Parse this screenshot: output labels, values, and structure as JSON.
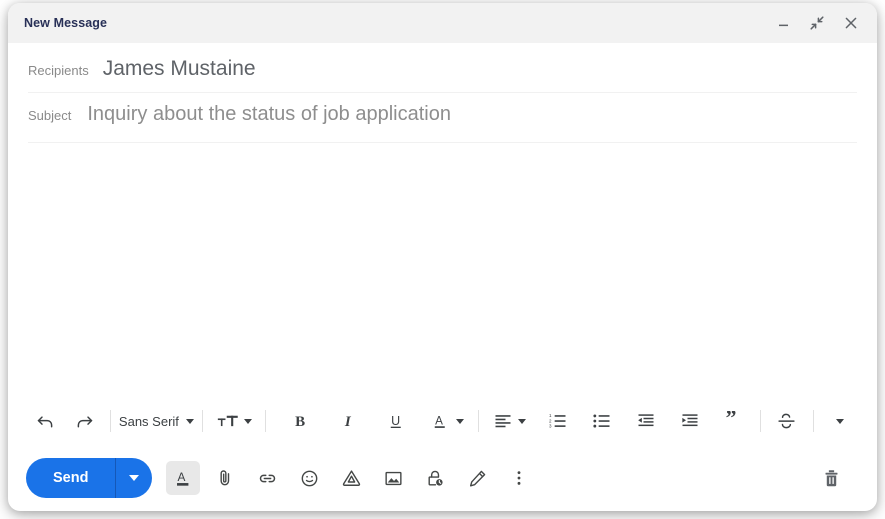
{
  "window": {
    "title": "New Message",
    "controls": [
      {
        "name": "minimize",
        "label": "Minimize"
      },
      {
        "name": "exit-full-screen",
        "label": "Exit full screen"
      },
      {
        "name": "close",
        "label": "Close"
      }
    ],
    "accent_blue": "#1a73e8",
    "header_bg": "#f2f2f2",
    "title_color": "#283057"
  },
  "fields": {
    "recipients_label": "Recipients",
    "recipients_value": "James Mustaine",
    "subject_label": "Subject",
    "subject_value": "Inquiry about the status of job application"
  },
  "body": {
    "text": ""
  },
  "format_toolbar": {
    "undo": "Undo",
    "redo": "Redo",
    "font_name": "Sans Serif",
    "text_size": "Size",
    "bold": "Bold",
    "italic": "Italic",
    "underline": "Underline",
    "text_color": "Text color",
    "align": "Align",
    "numbered_list": "Numbered list",
    "bulleted_list": "Bulleted list",
    "indent_less": "Indent less",
    "indent_more": "Indent more",
    "quote": "Quote",
    "strikethrough": "Strikethrough",
    "more_formatting": "More formatting options"
  },
  "action_bar": {
    "send_label": "Send",
    "send_options": "More send options",
    "formatting_options": "Formatting options",
    "attach_file": "Attach files",
    "insert_link": "Insert link",
    "insert_emoji": "Insert emoji",
    "insert_drive": "Insert files using Drive",
    "insert_photo": "Insert photo",
    "confidential_mode": "Toggle confidential mode",
    "insert_signature": "Insert signature",
    "more_options": "More options",
    "discard": "Discard draft"
  }
}
